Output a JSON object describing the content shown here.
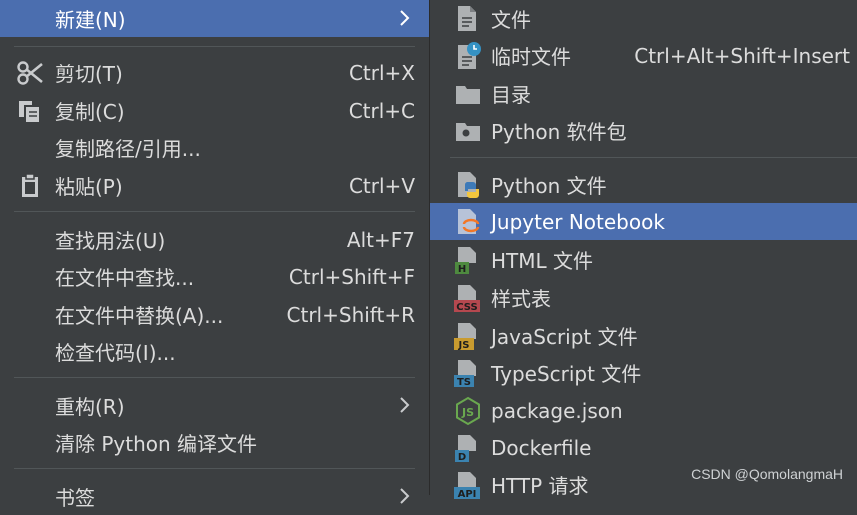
{
  "context_menu": {
    "items": [
      {
        "name": "new",
        "label": "新建(N)",
        "shortcut": "",
        "submenu": true,
        "selected": true,
        "icon": ""
      },
      {
        "name": "cut",
        "label": "剪切(T)",
        "shortcut": "Ctrl+X",
        "icon": "scissors-icon"
      },
      {
        "name": "copy",
        "label": "复制(C)",
        "shortcut": "Ctrl+C",
        "icon": "copy-icon"
      },
      {
        "name": "copy-path",
        "label": "复制路径/引用...",
        "shortcut": "",
        "icon": ""
      },
      {
        "name": "paste",
        "label": "粘贴(P)",
        "shortcut": "Ctrl+V",
        "icon": "clipboard-icon"
      },
      {
        "name": "find-usages",
        "label": "查找用法(U)",
        "shortcut": "Alt+F7",
        "icon": ""
      },
      {
        "name": "find-in-files",
        "label": "在文件中查找...",
        "shortcut": "Ctrl+Shift+F",
        "icon": ""
      },
      {
        "name": "replace-in-files",
        "label": "在文件中替换(A)...",
        "shortcut": "Ctrl+Shift+R",
        "icon": ""
      },
      {
        "name": "inspect-code",
        "label": "检查代码(I)...",
        "shortcut": "",
        "icon": ""
      },
      {
        "name": "refactor",
        "label": "重构(R)",
        "shortcut": "",
        "submenu": true,
        "icon": ""
      },
      {
        "name": "clean-python",
        "label": "清除 Python 编译文件",
        "shortcut": "",
        "icon": ""
      },
      {
        "name": "bookmarks",
        "label": "书签",
        "shortcut": "",
        "submenu": true,
        "icon": ""
      }
    ]
  },
  "submenu": {
    "items": [
      {
        "name": "file",
        "label": "文件",
        "shortcut": "",
        "icon": "file-icon"
      },
      {
        "name": "scratch-file",
        "label": "临时文件",
        "shortcut": "Ctrl+Alt+Shift+Insert",
        "icon": "scratch-file-icon"
      },
      {
        "name": "directory",
        "label": "目录",
        "shortcut": "",
        "icon": "folder-icon"
      },
      {
        "name": "python-package",
        "label": "Python 软件包",
        "shortcut": "",
        "icon": "package-folder-icon"
      },
      {
        "name": "python-file",
        "label": "Python 文件",
        "shortcut": "",
        "icon": "python-file-icon"
      },
      {
        "name": "jupyter-notebook",
        "label": "Jupyter Notebook",
        "shortcut": "",
        "selected": true,
        "icon": "jupyter-icon"
      },
      {
        "name": "html-file",
        "label": "HTML 文件",
        "shortcut": "",
        "icon": "html-file-icon",
        "badge": "H"
      },
      {
        "name": "stylesheet",
        "label": "样式表",
        "shortcut": "",
        "icon": "css-file-icon",
        "badge": "CSS"
      },
      {
        "name": "javascript-file",
        "label": "JavaScript 文件",
        "shortcut": "",
        "icon": "js-file-icon",
        "badge": "JS"
      },
      {
        "name": "typescript-file",
        "label": "TypeScript 文件",
        "shortcut": "",
        "icon": "ts-file-icon",
        "badge": "TS"
      },
      {
        "name": "package-json",
        "label": "package.json",
        "shortcut": "",
        "icon": "nodejs-icon"
      },
      {
        "name": "dockerfile",
        "label": "Dockerfile",
        "shortcut": "",
        "icon": "dockerfile-icon",
        "badge": "D"
      },
      {
        "name": "http-request",
        "label": "HTTP 请求",
        "shortcut": "",
        "icon": "http-request-icon",
        "badge": "API"
      }
    ]
  },
  "watermark": "CSDN @QomolangmaH",
  "colors": {
    "menu_bg": "#3c3f41",
    "selection": "#4b6eaf",
    "text": "#dcdcdc",
    "separator": "#515658",
    "html_badge": "#4e8a3f",
    "css_badge": "#b5484f",
    "js_badge": "#c99b2f",
    "ts_badge": "#3b83b0",
    "d_badge": "#3b83b0",
    "api_badge": "#3b83b0"
  }
}
